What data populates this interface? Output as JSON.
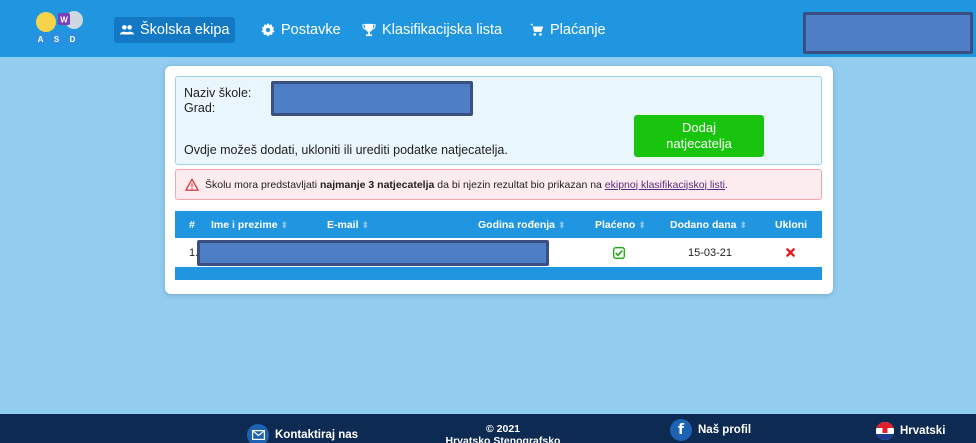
{
  "nav": {
    "logo_letters": [
      "W",
      "A",
      "S",
      "D"
    ],
    "items": [
      {
        "label": "Školska ekipa",
        "icon": "users-icon",
        "active": true
      },
      {
        "label": "Postavke",
        "icon": "gear-icon",
        "active": false
      },
      {
        "label": "Klasifikacijska lista",
        "icon": "trophy-icon",
        "active": false
      },
      {
        "label": "Plaćanje",
        "icon": "cart-icon",
        "active": false
      }
    ]
  },
  "school": {
    "name_label": "Naziv škole:",
    "city_label": "Grad:",
    "description": "Ovdje možeš dodati, ukloniti ili urediti podatke natjecatelja.",
    "add_button": "Dodaj natjecatelja"
  },
  "alert": {
    "text_before": "Školu mora predstavljati ",
    "text_bold": "najmanje 3 natjecatelja",
    "text_middle": " da bi njezin rezultat bio prikazan na ",
    "link_text": "ekipnoj klasifikacijskoj listi",
    "text_after": "."
  },
  "table": {
    "headers": [
      "#",
      "Ime i prezime",
      "E-mail",
      "Godina rođenja",
      "Plaćeno",
      "Dodano dana",
      "Ukloni"
    ],
    "rows": [
      {
        "index": "1.",
        "paid": true,
        "added": "15-03-21"
      }
    ]
  },
  "footer": {
    "contact": "Kontaktiraj nas",
    "copyright_line1": "© 2021",
    "copyright_line2": "Hrvatsko Stenografsko Društvo",
    "profile": "Naš profil",
    "language": "Hrvatski"
  },
  "colors": {
    "nav": "#2196e0",
    "background": "#92cdf0",
    "button": "#19c40e",
    "footer": "#0d2b52"
  }
}
